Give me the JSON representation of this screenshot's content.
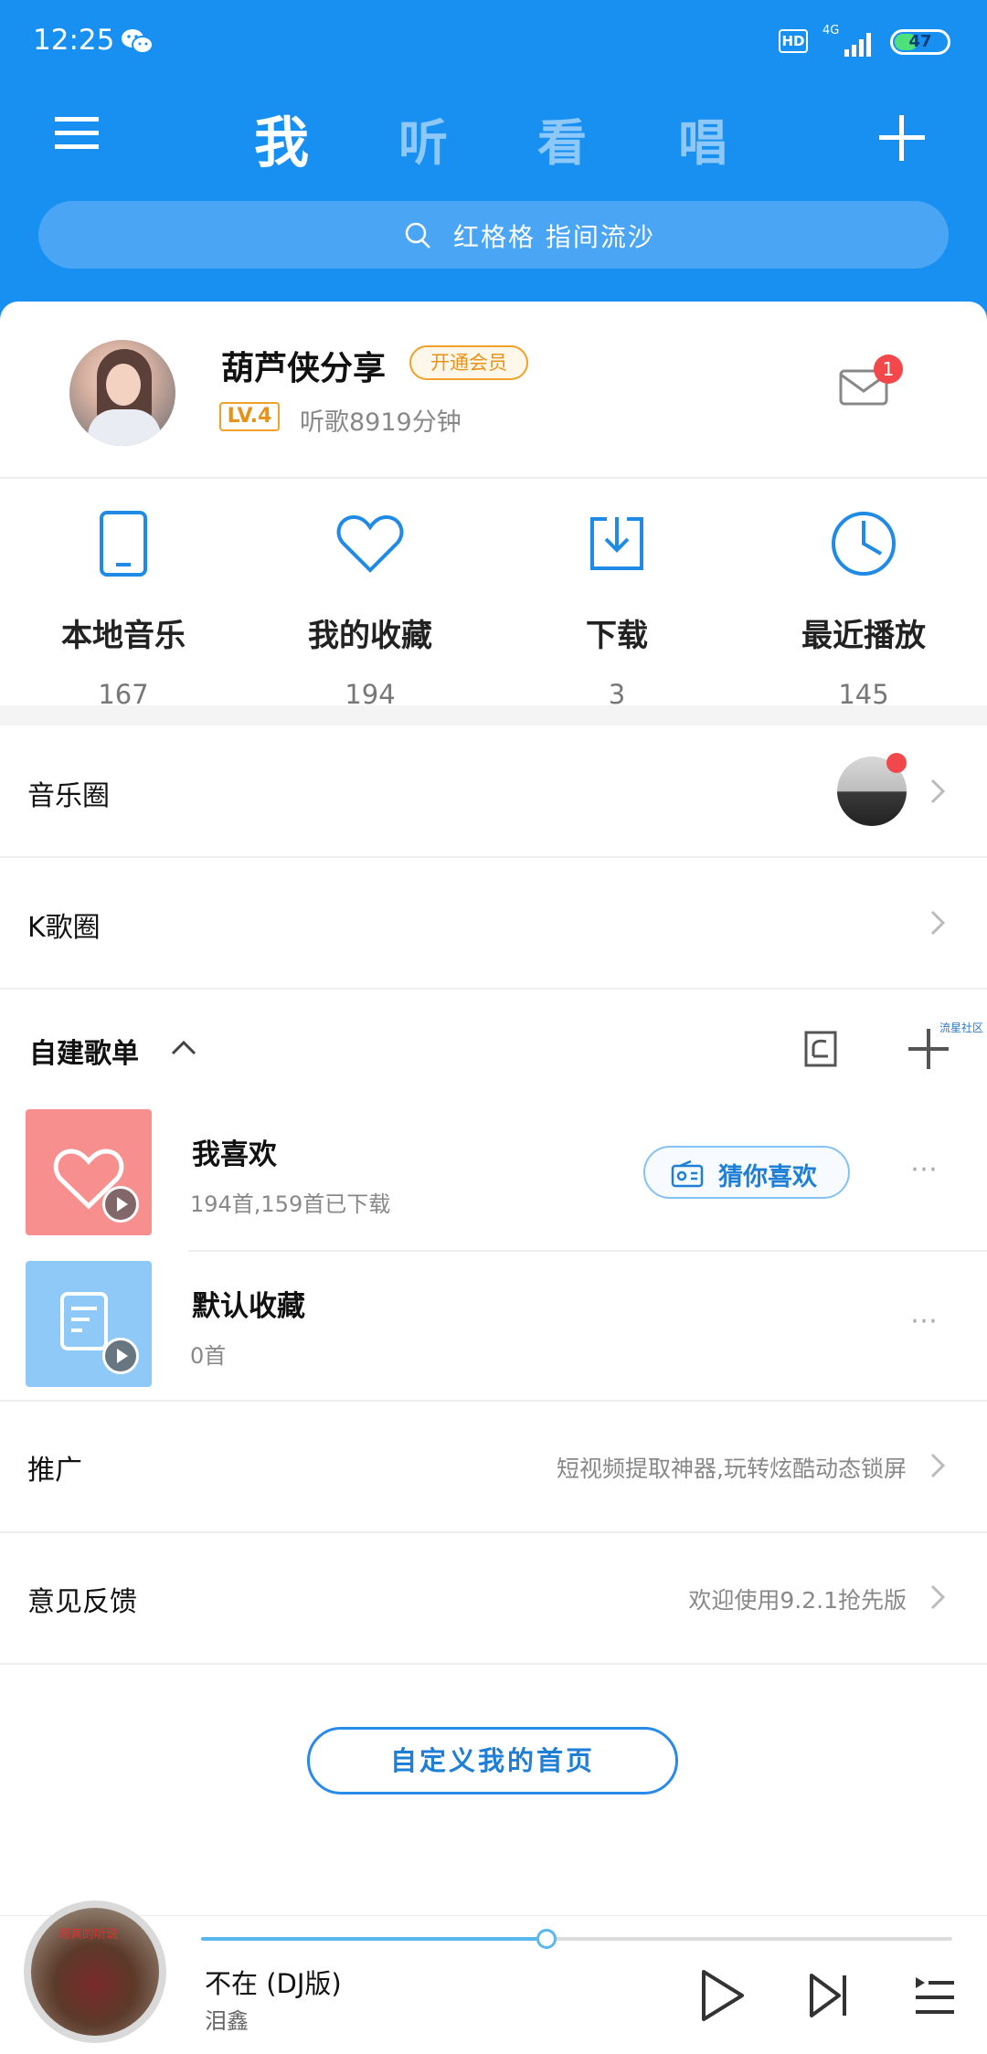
{
  "status": {
    "time": "12:25",
    "hd": "HD",
    "network": "4G",
    "battery": "47",
    "battery_level": 0.47
  },
  "header": {
    "tabs": [
      {
        "label": "我",
        "active": true
      },
      {
        "label": "听",
        "active": false
      },
      {
        "label": "看",
        "active": false
      },
      {
        "label": "唱",
        "active": false
      }
    ],
    "search_placeholder": "红格格 指间流沙"
  },
  "profile": {
    "name": "葫芦侠分享",
    "vip_label": "开通会员",
    "level": "LV.4",
    "listen_time": "听歌8919分钟",
    "mail_badge": "1"
  },
  "quick_access": [
    {
      "label": "本地音乐",
      "count": "167",
      "icon": "phone-icon"
    },
    {
      "label": "我的收藏",
      "count": "194",
      "icon": "heart-icon"
    },
    {
      "label": "下载",
      "count": "3",
      "icon": "download-icon"
    },
    {
      "label": "最近播放",
      "count": "145",
      "icon": "clock-icon"
    }
  ],
  "rows": {
    "music_circle": "音乐圈",
    "k_circle": "K歌圈"
  },
  "playlists": {
    "header": "自建歌单",
    "community_tag": "流星社区",
    "items": [
      {
        "title": "我喜欢",
        "subtitle": "194首,159首已下载",
        "cover_color": "#f78f8f"
      },
      {
        "title": "默认收藏",
        "subtitle": "0首",
        "cover_color": "#8ec9f7"
      }
    ],
    "guess_label": "猜你喜欢"
  },
  "promo": {
    "label": "推广",
    "value": "短视频提取神器,玩转炫酷动态锁屏"
  },
  "feedback": {
    "label": "意见反馈",
    "value": "欢迎使用9.2.1抢先版"
  },
  "custom_home_label": "自定义我的首页",
  "player": {
    "title": "不在 (DJ版)",
    "artist": "泪鑫",
    "progress": 0.46,
    "disc_text": "哥真的听说"
  },
  "colors": {
    "brand": "#1890f2",
    "accent": "#2a8ae8",
    "badge": "#f2484b",
    "vip": "#f0a12a"
  }
}
